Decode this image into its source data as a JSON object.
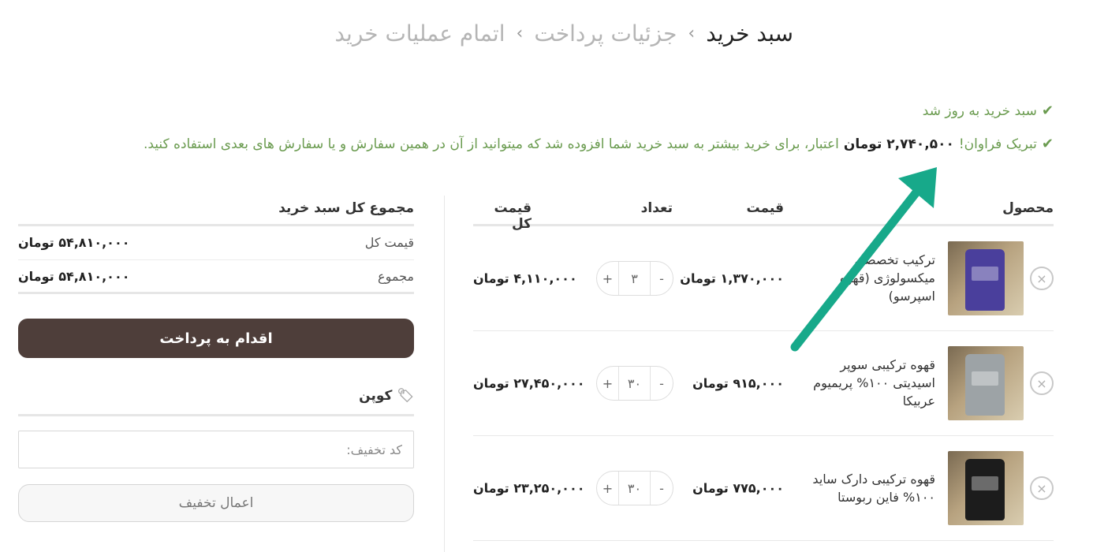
{
  "breadcrumb": {
    "current": "سبد خرید",
    "step2": "جزئیات پرداخت",
    "step3": "اتمام عملیات خرید",
    "separator": "›"
  },
  "notices": {
    "updated": "سبد خرید به روز شد",
    "credit_prefix": "تبریک فراوان!",
    "credit_amount": "۲,۷۴۰,۵۰۰ تومان",
    "credit_suffix": "اعتبار، برای خرید بیشتر به سبد خرید شما افزوده شد که میتوانید از آن در همین سفارش و یا سفارش های بعدی استفاده کنید."
  },
  "cart": {
    "headers": {
      "product": "محصول",
      "price": "قیمت",
      "quantity": "تعداد",
      "subtotal": "قیمت کل"
    },
    "items": [
      {
        "name": "ترکیب تخصصی میکسولوژی (قهوه اسپرسو)",
        "price": "۱,۳۷۰,۰۰۰ تومان",
        "quantity": "۳",
        "subtotal": "۴,۱۱۰,۰۰۰ تومان"
      },
      {
        "name": "قهوه ترکیبی سوپر اسیدیتی ۱۰۰% پریمیوم عربیکا",
        "price": "۹۱۵,۰۰۰ تومان",
        "quantity": "۳۰",
        "subtotal": "۲۷,۴۵۰,۰۰۰ تومان"
      },
      {
        "name": "قهوه ترکیبی دارک ساید ۱۰۰% فاین ربوستا",
        "price": "۷۷۵,۰۰۰ تومان",
        "quantity": "۳۰",
        "subtotal": "۲۳,۲۵۰,۰۰۰ تومان"
      }
    ],
    "plus": "+",
    "minus": "-",
    "remove": "×"
  },
  "totals": {
    "title": "مجموع کل سبد خرید",
    "subtotal_label": "قیمت کل",
    "subtotal_value": "۵۴,۸۱۰,۰۰۰ تومان",
    "total_label": "مجموع",
    "total_value": "۵۴,۸۱۰,۰۰۰ تومان",
    "checkout": "اقدام به پرداخت"
  },
  "coupon": {
    "title": "کوپن",
    "placeholder": "کد تخفیف:",
    "apply": "اعمال تخفیف"
  },
  "colors": {
    "success": "#6a9b4f",
    "checkout_button": "#4e3e3a",
    "arrow": "#17a98a"
  },
  "icons": {
    "check": "check-icon",
    "tag": "tag-icon",
    "remove": "close-circle-icon"
  }
}
